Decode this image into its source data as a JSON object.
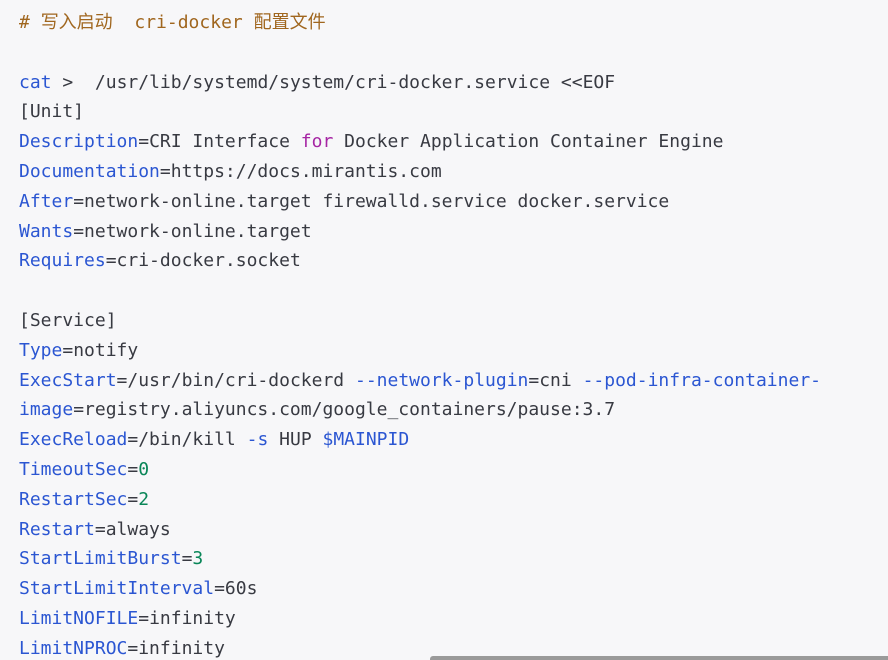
{
  "comment": {
    "hash": "#",
    "prefix": "写入启动",
    "name": "cri-docker",
    "suffix": "配置文件"
  },
  "cat_line": {
    "cmd": "cat",
    "redirect": ">",
    "path": "/usr/lib/systemd/system/cri-docker.service",
    "heredoc": "<<EOF"
  },
  "unit_header": "[Unit]",
  "unit": {
    "description_key": "Description",
    "description_a": "CRI Interface",
    "description_kw": "for",
    "description_b": "Docker Application Container Engine",
    "documentation_key": "Documentation",
    "documentation_value": "https://docs.mirantis.com",
    "after_key": "After",
    "after_value": "network-online.target firewalld.service docker.service",
    "wants_key": "Wants",
    "wants_value": "network-online.target",
    "requires_key": "Requires",
    "requires_value": "cri-docker.socket"
  },
  "service_header": "[Service]",
  "service": {
    "type_key": "Type",
    "type_value": "notify",
    "execstart_key": "ExecStart",
    "execstart_bin": "/usr/bin/cri-dockerd",
    "execstart_flag1": "--network-plugin",
    "execstart_flag1_value": "cni",
    "execstart_flag2": "--pod-infra-container-",
    "execstart_flag2_cont_key": "image",
    "execstart_flag2_cont_value": "registry.aliyuncs.com/google_containers/pause:3.7",
    "execreload_key": "ExecReload",
    "execreload_bin": "/bin/kill",
    "execreload_flag": "-s",
    "execreload_sig": "HUP",
    "execreload_var": "$MAINPID",
    "timeoutsec_key": "TimeoutSec",
    "timeoutsec_value": "0",
    "restartsec_key": "RestartSec",
    "restartsec_value": "2",
    "restart_key": "Restart",
    "restart_value": "always",
    "startlimitburst_key": "StartLimitBurst",
    "startlimitburst_value": "3",
    "startlimitinterval_key": "StartLimitInterval",
    "startlimitinterval_value": "60s",
    "limitnofile_key": "LimitNOFILE",
    "limitnofile_value": "infinity",
    "limitnproc_key": "LimitNPROC",
    "limitnproc_value": "infinity"
  },
  "eq": "="
}
